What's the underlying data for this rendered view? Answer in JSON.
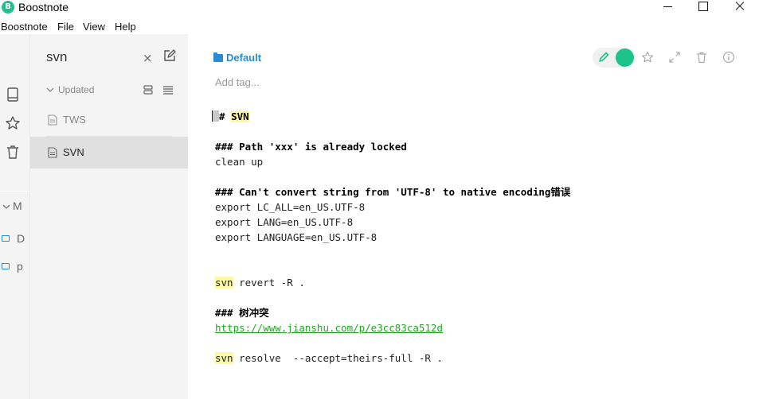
{
  "window": {
    "title": "Boostnote",
    "logo_glyph": "B"
  },
  "menu": [
    "Boostnote",
    "File",
    "View",
    "Help"
  ],
  "sidenav": {
    "storage_label": "M",
    "folders": [
      "D",
      "p"
    ]
  },
  "notelist": {
    "search_text": "svn",
    "clear_glyph": "×",
    "sort_label": "Updated",
    "notes": [
      {
        "title": "TWS",
        "active": false
      },
      {
        "title": "SVN",
        "active": true
      }
    ]
  },
  "editor": {
    "folder": "Default",
    "tag_placeholder": "Add tag...",
    "lines": {
      "h1_prefix": "# ",
      "h1_word": "SVN",
      "h3_path": "### Path 'xxx' is already locked",
      "cleanup": "clean up",
      "h3_convert": "### Can't convert string from 'UTF-8' to native encoding错误",
      "export_all": "export LC_ALL=en_US.UTF-8",
      "export_lang": "export LANG=en_US.UTF-8",
      "export_language": "export LANGUAGE=en_US.UTF-8",
      "revert_cmd": "svn",
      "revert_rest": " revert -R .",
      "h3_tree": "### 树冲突",
      "link": "https://www.jianshu.com/p/e3cc83ca512d",
      "resolve_cmd": "svn",
      "resolve_rest": " resolve  --accept=theirs-full -R ."
    }
  },
  "colors": {
    "accent": "#1ec38b",
    "link_blue": "#2a8bd4",
    "highlight": "#fdf8a6",
    "link_green": "#1ea91e"
  }
}
